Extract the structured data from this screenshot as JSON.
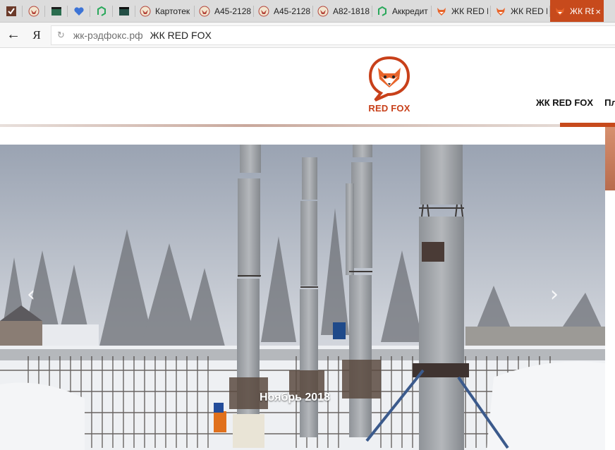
{
  "browser": {
    "tabs": [
      {
        "type": "pinned",
        "icon": "checklist-icon"
      },
      {
        "type": "pinned",
        "icon": "eagle-emblem-icon"
      },
      {
        "type": "pinned",
        "icon": "green-window-icon"
      },
      {
        "type": "pinned",
        "icon": "blue-heart-icon"
      },
      {
        "type": "pinned",
        "icon": "green-leaf-icon"
      },
      {
        "type": "pinned",
        "icon": "dark-window-icon"
      },
      {
        "type": "normal",
        "icon": "eagle-emblem-icon",
        "label": "Картотек"
      },
      {
        "type": "normal",
        "icon": "eagle-emblem-icon",
        "label": "А45-2128"
      },
      {
        "type": "normal",
        "icon": "eagle-emblem-icon",
        "label": "А45-2128"
      },
      {
        "type": "normal",
        "icon": "eagle-emblem-icon",
        "label": "А82-1818"
      },
      {
        "type": "normal",
        "icon": "green-leaf-icon",
        "label": "Аккредит"
      },
      {
        "type": "normal",
        "icon": "fox-icon",
        "label": "ЖК RED F"
      },
      {
        "type": "normal",
        "icon": "fox-icon",
        "label": "ЖК RED F"
      },
      {
        "type": "active",
        "icon": "fox-icon",
        "label": "ЖК RE",
        "close": "×"
      }
    ],
    "nav": {
      "back": "←",
      "yandex": "Я",
      "reload": "↻"
    },
    "address": {
      "host": "жк-рэдфокс.рф",
      "title": "ЖК RED FOX"
    }
  },
  "site": {
    "logo_text": "RED FOX",
    "nav_items": [
      "ЖК RED FOX",
      "Пла"
    ],
    "colors": {
      "brand": "#c74a1c"
    }
  },
  "slider": {
    "caption": "Ноябрь 2018",
    "prev": "‹",
    "next": "›"
  }
}
